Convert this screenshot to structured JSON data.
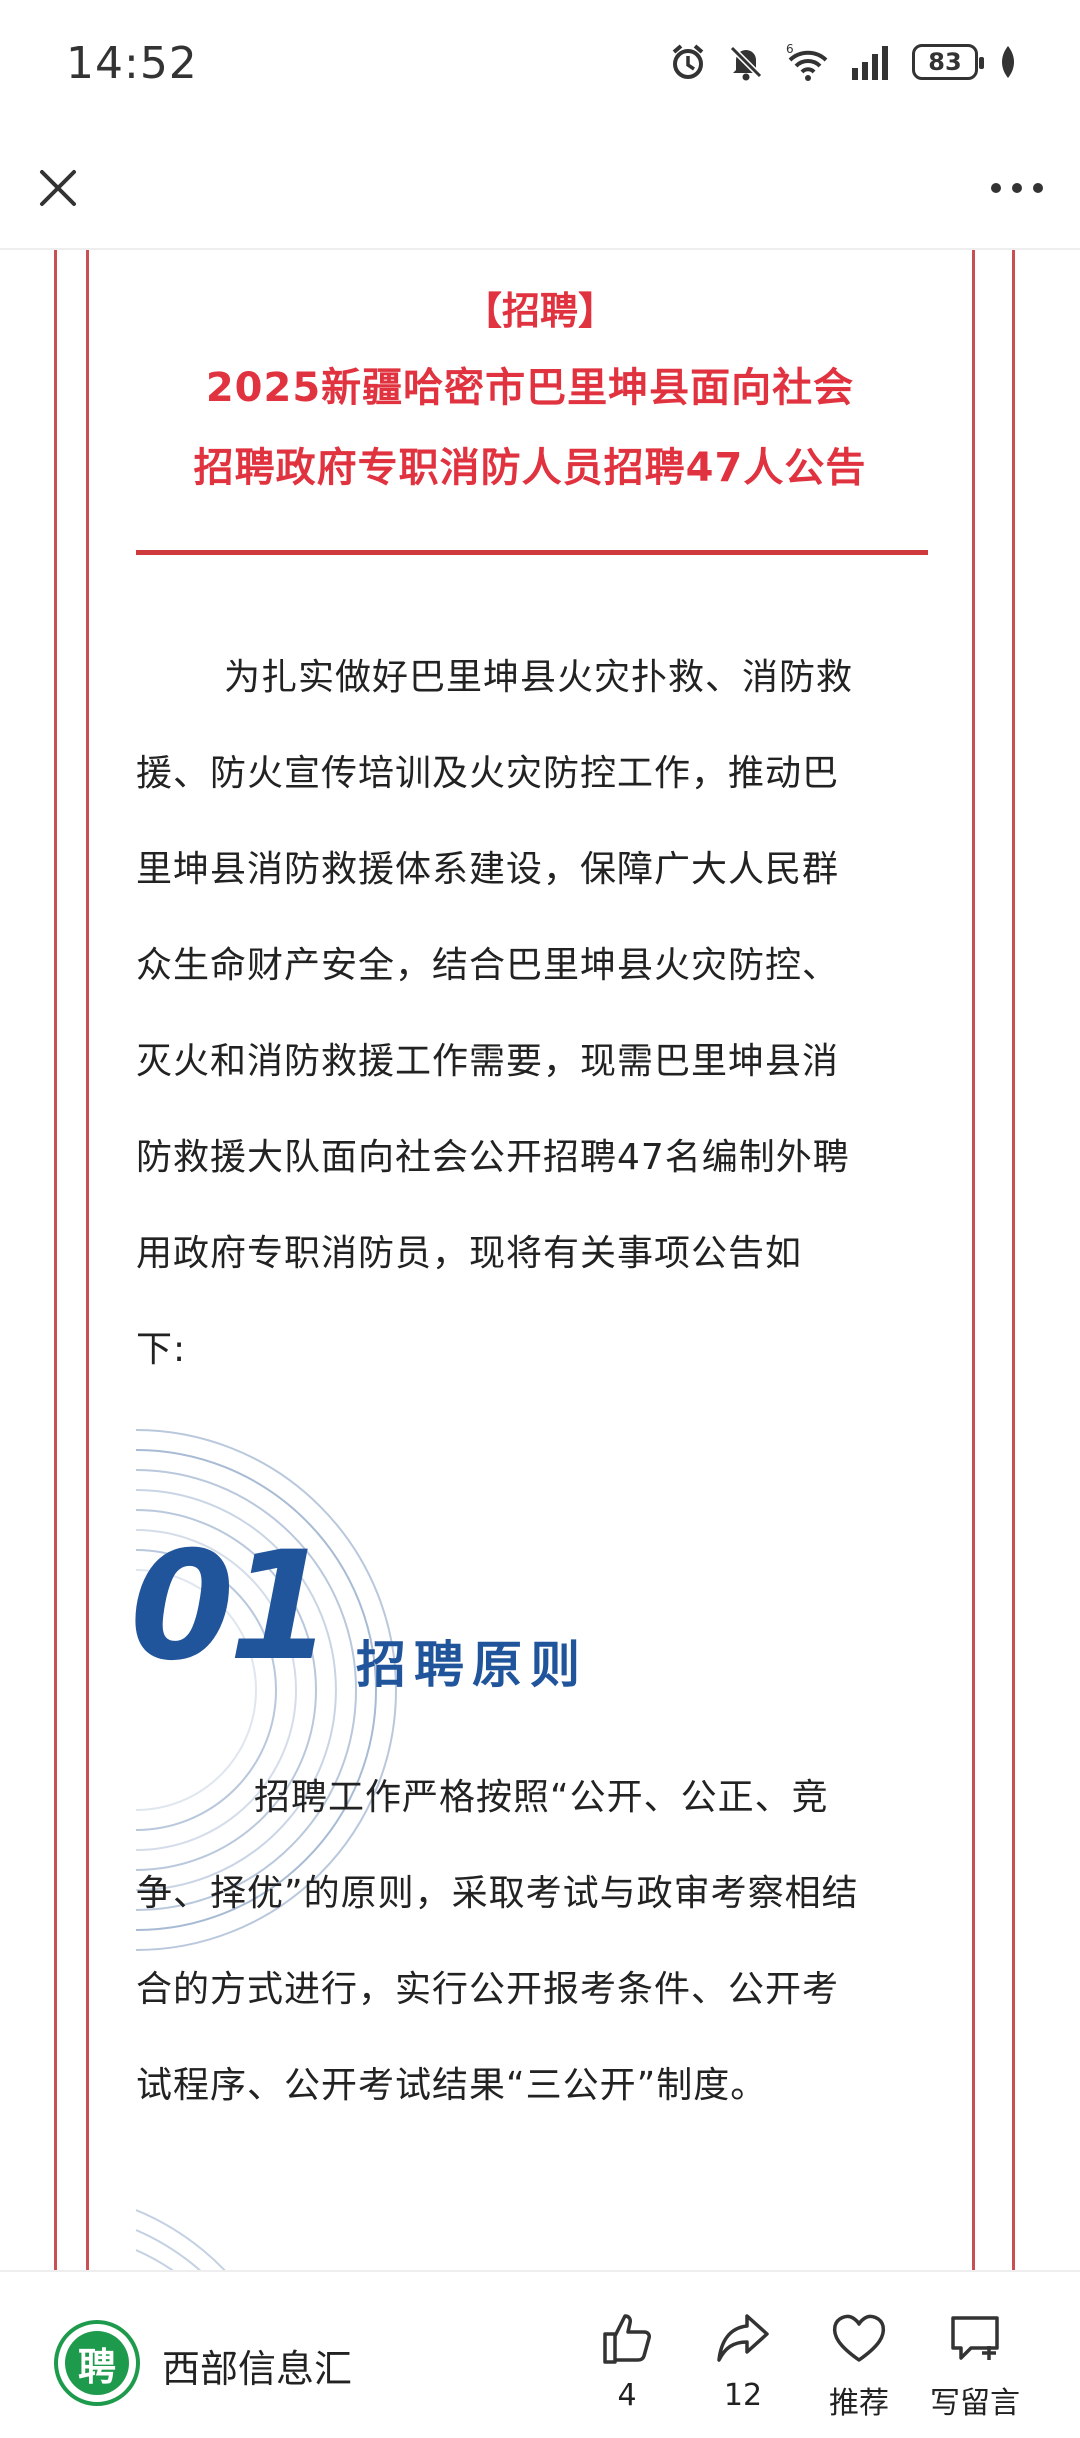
{
  "status_bar": {
    "time": "14:52",
    "battery": "83",
    "icons": [
      "alarm-icon",
      "mute-bell-icon",
      "wifi-6-icon",
      "signal-icon",
      "battery-icon",
      "leaf-icon"
    ]
  },
  "nav": {
    "close_icon": "close-icon",
    "more_icon": "more-dots-icon"
  },
  "article": {
    "tag": "【招聘】",
    "title_lines": [
      "2025新疆哈密市巴里坤县面向社会",
      "招聘政府专职消防人员招聘47人公告"
    ],
    "intro_lines": [
      "为扎实做好巴里坤县火灾扑救、消防救",
      "援、防火宣传培训及火灾防控工作，推动巴",
      "里坤县消防救援体系建设，保障广大人民群",
      "众生命财产安全，结合巴里坤县火灾防控、",
      "灭火和消防救援工作需要，现需巴里坤县消",
      "防救援大队面向社会公开招聘47名编制外聘",
      "用政府专职消防员，现将有关事项公告如",
      "下:"
    ],
    "section1": {
      "number": "01",
      "title": "招聘原则",
      "lines": [
        "招聘工作严格按照“公开、公正、竞",
        "争、择优”的原则，采取考试与政审考察相结",
        "合的方式进行，实行公开报考条件、公开考",
        "试程序、公开考试结果“三公开”制度。"
      ]
    },
    "colors": {
      "title_red": "#e0323f",
      "frame_red": "#c95052",
      "section_blue": "#21559b"
    }
  },
  "bottom_bar": {
    "account_avatar_text": "聘",
    "account_name": "西部信息汇",
    "like_count": "4",
    "share_count": "12",
    "recommend_label": "推荐",
    "comment_label": "写留言",
    "avatar_color": "#1e9a4c"
  }
}
